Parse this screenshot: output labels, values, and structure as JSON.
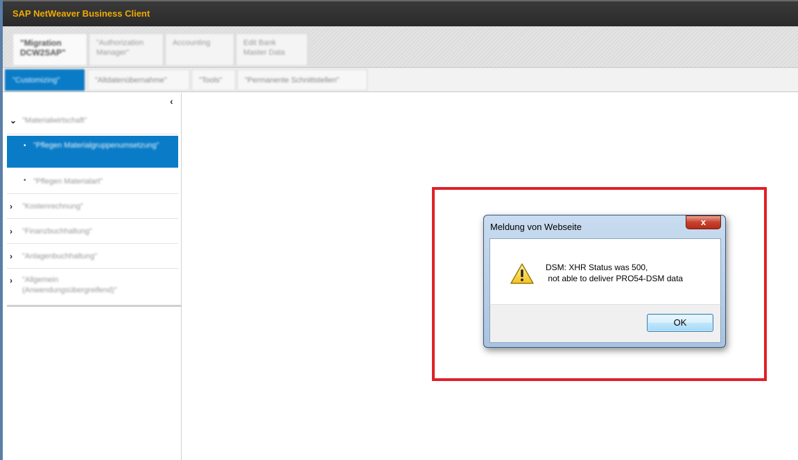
{
  "app": {
    "title": "SAP NetWeaver Business Client"
  },
  "work_centers": [
    {
      "label": "\"Migration DCW2SAP\"",
      "active": true
    },
    {
      "label": "\"Authorization Manager\"",
      "active": false
    },
    {
      "label": "Accounting",
      "active": false
    },
    {
      "label": "Edit Bank Master Data",
      "active": false
    }
  ],
  "sub_tabs": [
    {
      "label": "\"Customizing\"",
      "active": true
    },
    {
      "label": "\"Altdatenübernahme\"",
      "active": false
    },
    {
      "label": "\"Tools\"",
      "active": false
    },
    {
      "label": "\"Permanente Schnittstellen\"",
      "active": false
    }
  ],
  "nav": {
    "collapse_glyph": "‹",
    "items": [
      {
        "label": "\"Materialwirtschaft\"",
        "expanded": true
      },
      {
        "label": "\"Pflegen Materialgruppenumsetzung\"",
        "selected": true
      },
      {
        "label": "\"Pflegen Materialart\""
      },
      {
        "label": "\"Kostenrechnung\""
      },
      {
        "label": "\"Finanzbuchhaltung\""
      },
      {
        "label": "\"Anlagenbuchhaltung\""
      },
      {
        "label": "\"Allgemein (Anwendungsübergreifend)\""
      }
    ]
  },
  "dialog": {
    "title": "Meldung von Webseite",
    "close_glyph": "x",
    "message_line1": "DSM: XHR Status was 500,",
    "message_line2": " not able to deliver PRO54-DSM data",
    "ok_label": "OK",
    "icon": "warning-icon"
  },
  "colors": {
    "title_text": "#f0ab00",
    "selection": "#0a7cc7",
    "highlight_frame": "#e02028"
  }
}
